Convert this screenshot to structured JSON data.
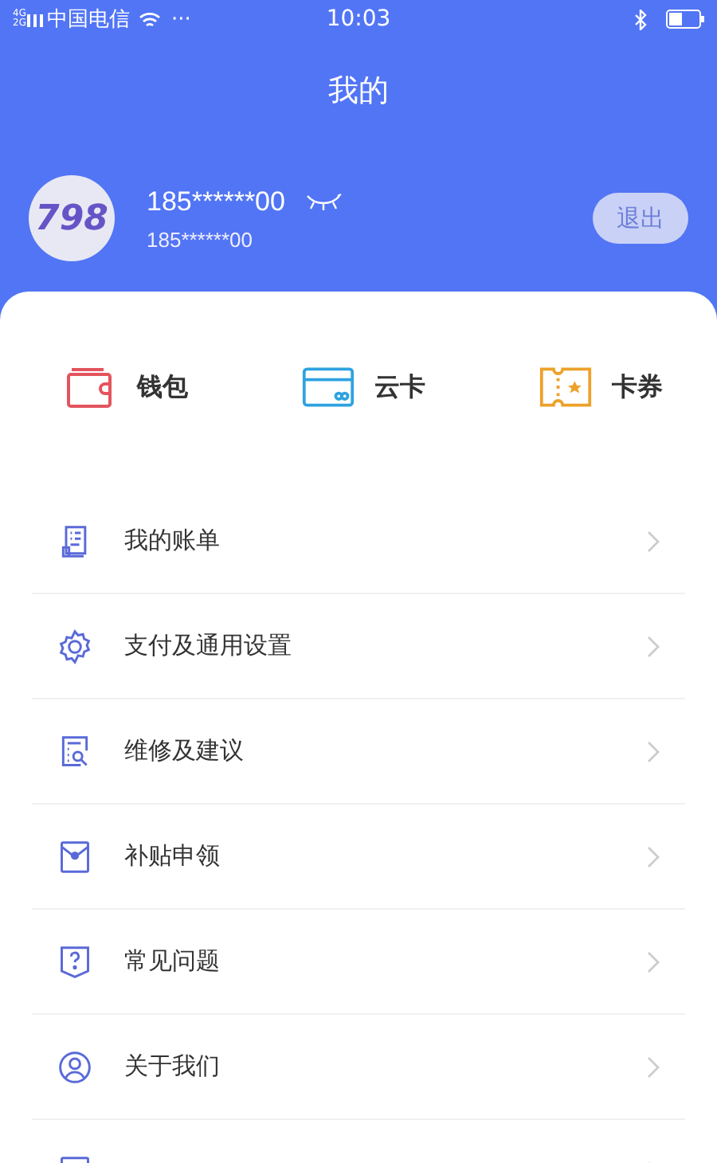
{
  "status_bar": {
    "network_top": "4G",
    "network_bottom": "2G",
    "carrier": "中国电信",
    "more": "···",
    "time": "10:03"
  },
  "header": {
    "title": "我的"
  },
  "profile": {
    "avatar_text": "798",
    "name": "185******00",
    "subtitle": "185******00",
    "logout": "退出"
  },
  "shortcuts": [
    {
      "kind": "wallet",
      "label": "钱包",
      "color": "#e4545e"
    },
    {
      "kind": "card",
      "label": "云卡",
      "color": "#2fa2e0"
    },
    {
      "kind": "coupon",
      "label": "卡券",
      "color": "#eda12a"
    }
  ],
  "menu": [
    {
      "kind": "bill",
      "label": "我的账单"
    },
    {
      "kind": "gear",
      "label": "支付及通用设置"
    },
    {
      "kind": "repair",
      "label": "维修及建议"
    },
    {
      "kind": "subsidy",
      "label": "补贴申领"
    },
    {
      "kind": "faq",
      "label": "常见问题"
    },
    {
      "kind": "about",
      "label": "关于我们"
    },
    {
      "kind": "partial"
    }
  ]
}
